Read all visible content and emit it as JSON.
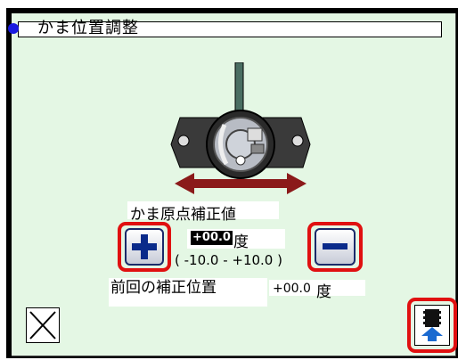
{
  "title": "かま位置調整",
  "colors": {
    "panel_bg": "#e4f7e4",
    "highlight": "#e01010",
    "title_dot": "#1a1ae0",
    "arrow": "#8b1a1a",
    "button_glyph": "#0a2a8a"
  },
  "adjustment": {
    "label": "かま原点補正値",
    "value": "+00.0",
    "unit": "度",
    "range_text": "( -10.0  -  +10.0 )"
  },
  "previous": {
    "label": "前回の補正位置",
    "value": "+00.0",
    "unit": "度"
  },
  "buttons": {
    "plus_icon": "plus-icon",
    "minus_icon": "minus-icon",
    "close_icon": "close-x-icon",
    "exit_icon": "machine-exit-icon"
  }
}
